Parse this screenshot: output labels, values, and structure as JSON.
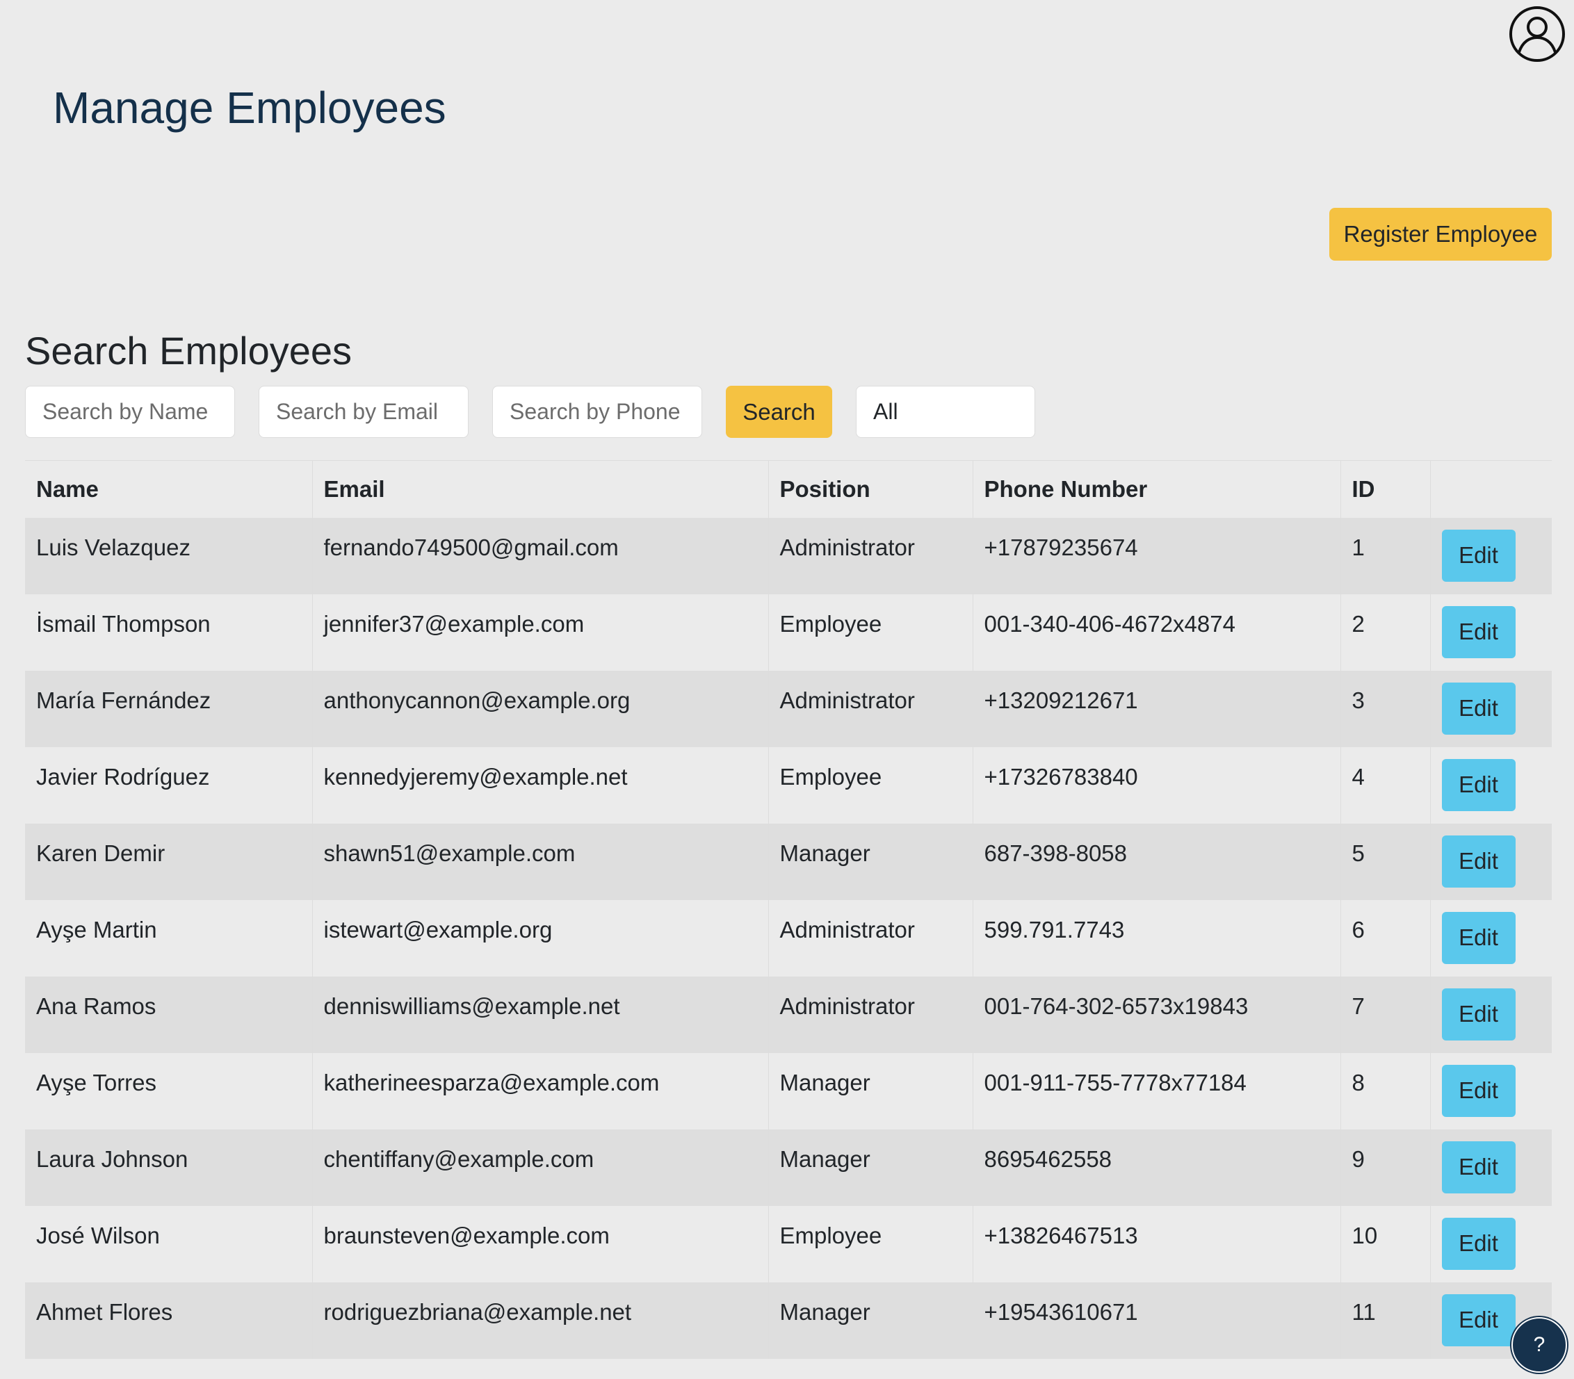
{
  "header": {
    "title": "Manage Employees",
    "profile_icon": "user-circle-icon",
    "register_label": "Register Employee"
  },
  "search": {
    "title": "Search Employees",
    "name_placeholder": "Search by Name",
    "email_placeholder": "Search by Email",
    "phone_placeholder": "Search by Phone",
    "button_label": "Search",
    "filter_value": "All"
  },
  "table": {
    "columns": [
      "Name",
      "Email",
      "Position",
      "Phone Number",
      "ID",
      ""
    ],
    "rows": [
      {
        "name": "Luis Velazquez",
        "email": "fernando749500@gmail.com",
        "position": "Administrator",
        "phone": "+17879235674",
        "id": "1",
        "action": "Edit"
      },
      {
        "name": "İsmail Thompson",
        "email": "jennifer37@example.com",
        "position": "Employee",
        "phone": "001-340-406-4672x4874",
        "id": "2",
        "action": "Edit"
      },
      {
        "name": "María Fernández",
        "email": "anthonycannon@example.org",
        "position": "Administrator",
        "phone": "+13209212671",
        "id": "3",
        "action": "Edit"
      },
      {
        "name": "Javier Rodríguez",
        "email": "kennedyjeremy@example.net",
        "position": "Employee",
        "phone": "+17326783840",
        "id": "4",
        "action": "Edit"
      },
      {
        "name": "Karen Demir",
        "email": "shawn51@example.com",
        "position": "Manager",
        "phone": "687-398-8058",
        "id": "5",
        "action": "Edit"
      },
      {
        "name": "Ayşe Martin",
        "email": "istewart@example.org",
        "position": "Administrator",
        "phone": "599.791.7743",
        "id": "6",
        "action": "Edit"
      },
      {
        "name": "Ana Ramos",
        "email": "denniswilliams@example.net",
        "position": "Administrator",
        "phone": "001-764-302-6573x19843",
        "id": "7",
        "action": "Edit"
      },
      {
        "name": "Ayşe Torres",
        "email": "katherineesparza@example.com",
        "position": "Manager",
        "phone": "001-911-755-7778x77184",
        "id": "8",
        "action": "Edit"
      },
      {
        "name": "Laura Johnson",
        "email": "chentiffany@example.com",
        "position": "Manager",
        "phone": "8695462558",
        "id": "9",
        "action": "Edit"
      },
      {
        "name": "José Wilson",
        "email": "braunsteven@example.com",
        "position": "Employee",
        "phone": "+13826467513",
        "id": "10",
        "action": "Edit"
      },
      {
        "name": "Ahmet Flores",
        "email": "rodriguezbriana@example.net",
        "position": "Manager",
        "phone": "+19543610671",
        "id": "11",
        "action": "Edit"
      }
    ]
  },
  "help": {
    "label": "?",
    "icon": "help-icon"
  },
  "colors": {
    "background": "#ebebeb",
    "title": "#14304a",
    "primary_yellow": "#f5c242",
    "edit_blue": "#5ac8ec",
    "help_bg": "#16324d"
  }
}
